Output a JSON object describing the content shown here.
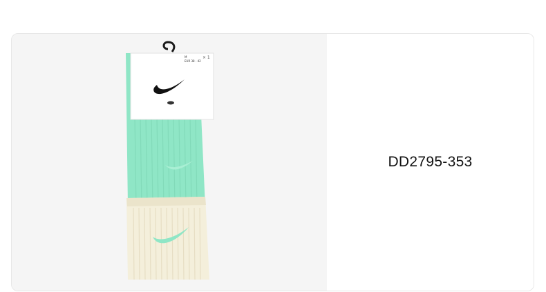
{
  "product": {
    "sku": "DD2795-353",
    "image_alt": "Nike crew socks in mint green and cream",
    "tag_size": "M",
    "tag_size_range": "EUR 38 - 42",
    "tag_quantity": "× 1",
    "colors": {
      "mint": "#8fe6c6",
      "cream": "#f4efdb",
      "image_background": "#f5f5f5"
    }
  }
}
